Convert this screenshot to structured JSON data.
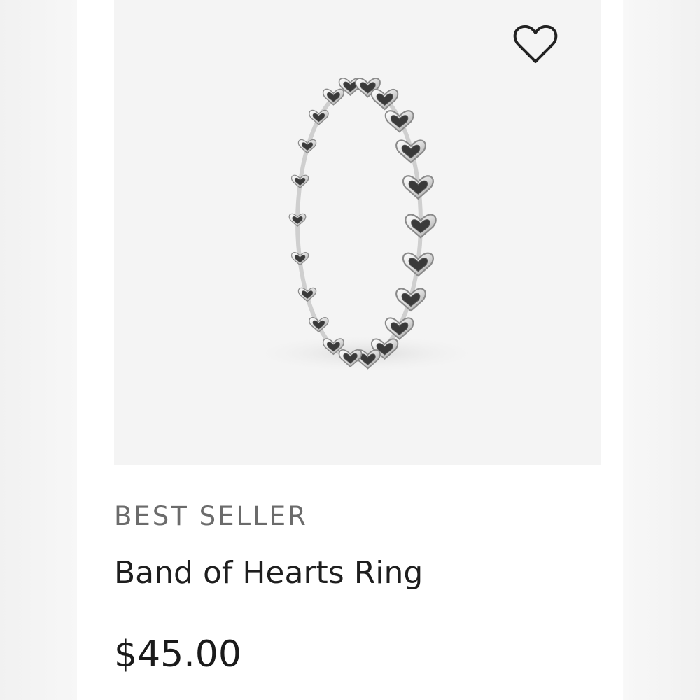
{
  "product": {
    "badge": "BEST SELLER",
    "name": "Band of Hearts Ring",
    "price": "$45.00",
    "image_subject": "ring-band-of-hearts",
    "wishlist_icon": "heart-outline-icon"
  },
  "colors": {
    "image_background": "#f4f4f4",
    "badge_text": "#6b6b6b",
    "title_text": "#1e1e1e",
    "price_text": "#1a1a1a",
    "icon_stroke": "#222222"
  }
}
